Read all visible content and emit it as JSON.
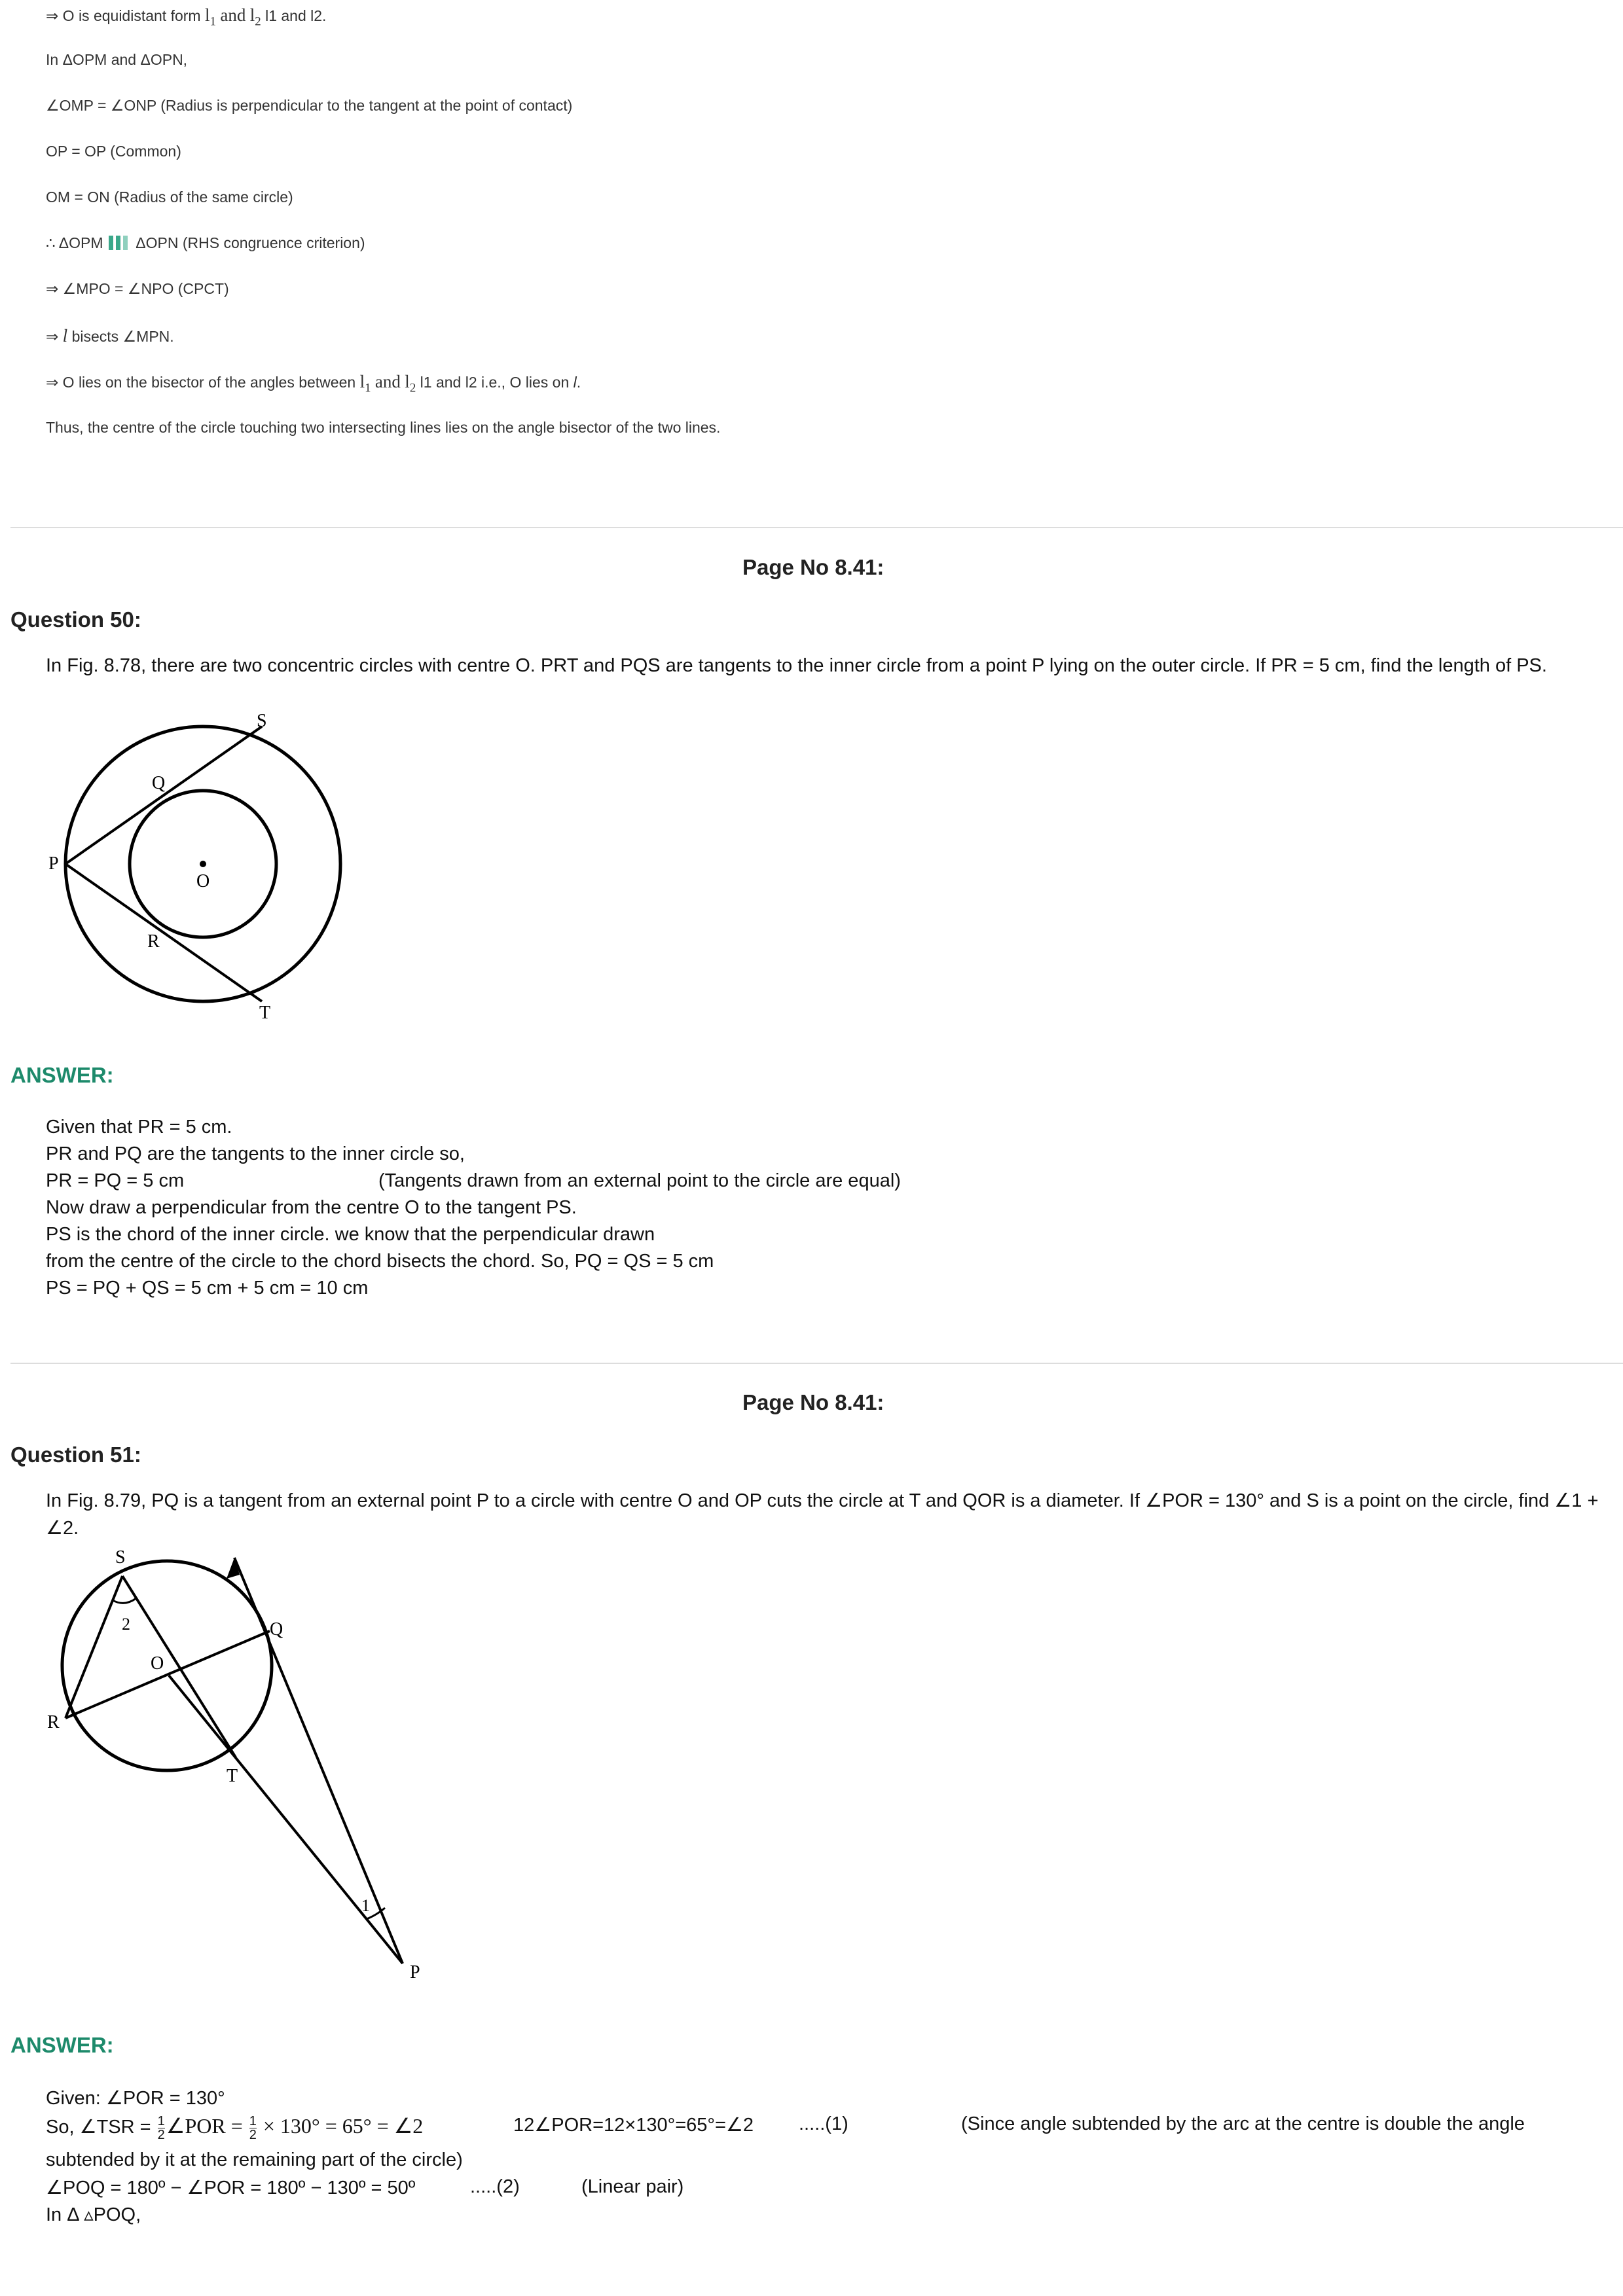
{
  "top": {
    "line1_prefix": "⇒ O is equidistant form",
    "l1": "l",
    "sub1": "1",
    "and": "and",
    "l2": "l",
    "sub2": "2",
    "line1_suffix": "l1 and l2.",
    "line2": "In ΔOPM and ΔOPN,",
    "line3": "∠OMP =  ∠ONP  (Radius is perpendicular to the tangent at the point of contact)",
    "line4": "OP = OP  (Common)",
    "line5": "OM = ON    (Radius of the same circle)",
    "line6_prefix": "∴ ΔOPM",
    "line6_suffix": "ΔOPN    (RHS congruence criterion)",
    "line7": "⇒ ∠MPO = ∠NPO  (CPCT)",
    "line8_l": "l",
    "line8_rest": " bisects ∠MPN.",
    "line8_arrow": "⇒ ",
    "line9_prefix": "⇒ O lies on the bisector of the angles between",
    "line9_suffix": "l1 and l2 i.e., O lies on",
    "line9_l": "l",
    "line10": "Thus, the centre of the circle touching two intersecting lines lies on the angle bisector of the two lines.",
    "cong_colors": [
      "#3aa88a",
      "#3aa88a",
      "#8fd0be"
    ]
  },
  "q50": {
    "page": "Page No 8.41:",
    "title": "Question 50:",
    "text": "In Fig. 8.78, there are two concentric circles with centre O. PRT and PQS are tangents to the inner circle from a point P lying on the outer circle. If PR = 5 cm, find the length of PS.",
    "fig": {
      "S": "S",
      "Q": "Q",
      "P": "P",
      "O": "O",
      "R": "R",
      "T": "T"
    },
    "answer_label": "ANSWER:",
    "a1": "Given that PR = 5 cm.",
    "a2": "PR and PQ are the tangents to the inner circle so,",
    "a3": "PR = PQ = 5 cm",
    "a3b": "(Tangents drawn from an external point to the circle are equal)",
    "a4": "Now draw a perpendicular from the centre O to the tangent PS.",
    "a5": "PS is the chord of the inner circle. we know that the perpendicular drawn",
    "a6": "from the centre of the circle to the chord bisects the chord. So, PQ = QS = 5 cm",
    "a7": "PS = PQ + QS = 5 cm + 5 cm = 10 cm"
  },
  "q51": {
    "page": "Page No 8.41:",
    "title": "Question 51:",
    "text": "In Fig. 8.79, PQ is a tangent from an external point P to a circle with centre O and OP cuts the circle at T and QOR is a diameter. If ∠POR = 130° and S is a point on the circle, find ∠1 + ∠2.",
    "fig": {
      "S": "S",
      "two": "2",
      "Q": "Q",
      "O": "O",
      "R": "R",
      "T": "T",
      "one": "1",
      "P": "P"
    },
    "answer_label": "ANSWER:",
    "a1": "Given: ∠POR = 130°",
    "a2_prefix": "So, ∠TSR = ",
    "a2_half": "1",
    "a2_den": "2",
    "a2_mid": "∠POR = ",
    "a2_mid2": " × 130° = 65° = ∠2",
    "a2_alt": "12∠POR=12×130°=65°=∠2",
    "a2_ref": ".....(1)",
    "a2_reason": "(Since angle subtended by the arc at the centre is double   the angle",
    "a3": "subtended by it at the remaining part of the circle)",
    "a4": "∠POQ = 180º − ∠POR = 180º − 130º = 50º",
    "a4_ref": ".....(2)",
    "a4_reason": "(Linear pair)",
    "a5": "In Δ ▵POQ,"
  }
}
